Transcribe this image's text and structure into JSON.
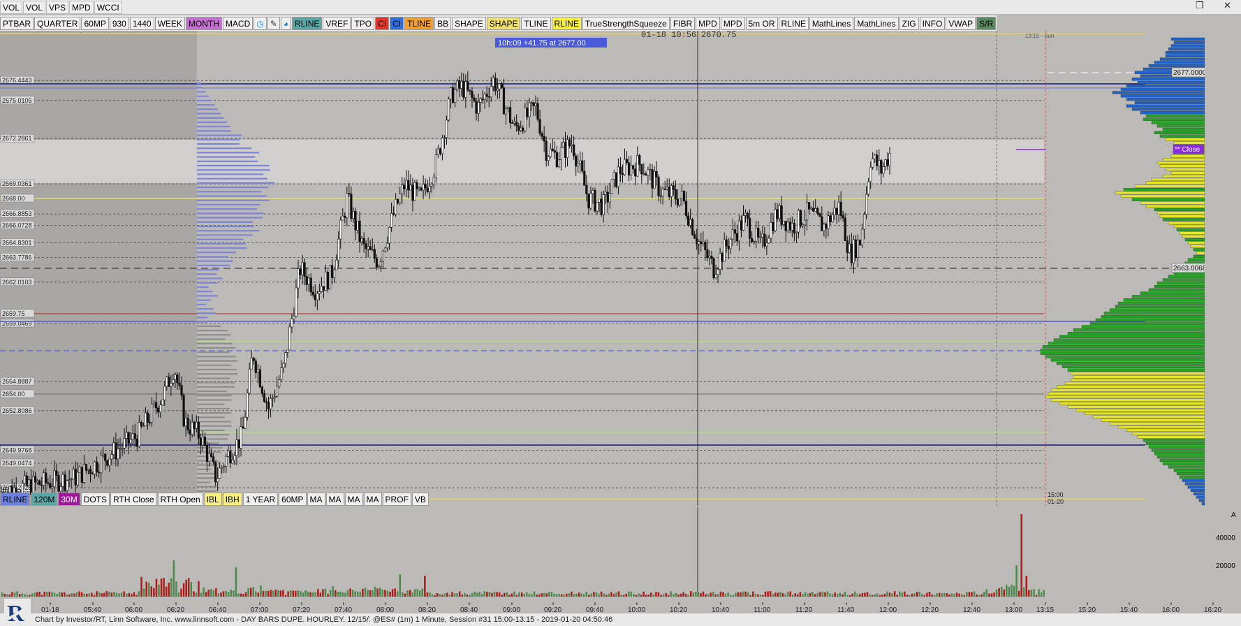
{
  "top_menu": [
    "VOL",
    "VOL",
    "VPS",
    "MPD",
    "WCCI"
  ],
  "window_controls": {
    "restore_icon": "restore-icon",
    "close_icon": "close-icon"
  },
  "toolbar": [
    {
      "label": "PTBAR"
    },
    {
      "label": "QUARTER"
    },
    {
      "label": "60MP"
    },
    {
      "label": "930"
    },
    {
      "label": "1440"
    },
    {
      "label": "WEEK"
    },
    {
      "label": "MONTH",
      "bg": "#c86fd6"
    },
    {
      "label": "MACD"
    },
    {
      "icon": "clock-icon",
      "glyph": "◷",
      "fg": "#1a7bd8"
    },
    {
      "icon": "pencil-icon",
      "glyph": "✎",
      "fg": "#333"
    },
    {
      "icon": "palette-icon",
      "glyph": "◕",
      "fg": "#1a7bd8"
    },
    {
      "label": "RLINE",
      "bg": "#5aa7a6"
    },
    {
      "label": "VREF"
    },
    {
      "label": "TPO"
    },
    {
      "label": "CI",
      "bg": "#e5352b"
    },
    {
      "label": "CI",
      "bg": "#2e6fe0"
    },
    {
      "label": "TLINE",
      "bg": "#f0a030"
    },
    {
      "label": "BB"
    },
    {
      "label": "SHAPE"
    },
    {
      "label": "SHAPE",
      "bg": "#f0e070"
    },
    {
      "label": "TLINE"
    },
    {
      "label": "RLINE",
      "bg": "#f7f040"
    },
    {
      "label": "TrueStrengthSqueeze"
    },
    {
      "label": "FIBR"
    },
    {
      "label": "MPD"
    },
    {
      "label": "MPD"
    },
    {
      "label": "5m OR"
    },
    {
      "label": "RLINE"
    },
    {
      "label": "MathLines"
    },
    {
      "label": "MathLines"
    },
    {
      "label": "ZIG"
    },
    {
      "label": "INFO"
    },
    {
      "label": "VWAP"
    },
    {
      "label": "S/R",
      "bg": "#5c8a60"
    }
  ],
  "bottom_toolbar": [
    {
      "label": "RLINE",
      "bg": "#6d7fe0"
    },
    {
      "label": "120M",
      "bg": "#5aa7a6"
    },
    {
      "label": "30M",
      "bg": "#a0189a",
      "fg": "#fff"
    },
    {
      "label": "DOTS"
    },
    {
      "label": "RTH Close"
    },
    {
      "label": "RTH Open"
    },
    {
      "label": "IBL",
      "bg": "#f7f080"
    },
    {
      "label": "IBH",
      "bg": "#f7f080"
    },
    {
      "label": "1 YEAR"
    },
    {
      "label": "60MP"
    },
    {
      "label": "MA"
    },
    {
      "label": "MA"
    },
    {
      "label": "MA"
    },
    {
      "label": "MA"
    },
    {
      "label": "PROF"
    },
    {
      "label": "VB"
    }
  ],
  "chart_overlay": {
    "tooltip": "10h:09  +41.75 at 2677.00",
    "cursor_readout": "01-18 10:56",
    "cursor_price": "2670.75",
    "cursor_time_label": "13:15 - Sun",
    "session_end_label": "15:00",
    "session_end_date": "01-20",
    "close_label": "** Close",
    "close_price": "2671.50",
    "level_2677": "2677.0000",
    "level_2663": "2663.0068",
    "level_green_1": "2657.75",
    "level_green_2": "2651.25"
  },
  "colors": {
    "background": "#bcbab7",
    "up": "#4d8a4d",
    "down": "#b21a1a",
    "profile_green": "#22a322",
    "profile_yellow": "#e5e628",
    "profile_blue": "#1f62c9",
    "left_profile": "#7e84d8"
  },
  "chart_data": {
    "type": "candlestick",
    "price_axis_ticks": [
      "2675",
      "2670",
      "2665",
      "2660",
      "2655",
      "2650"
    ],
    "price_range": [
      2646,
      2680
    ],
    "time_axis_ticks": [
      "01-18",
      "05:40",
      "06:00",
      "06:20",
      "06:40",
      "07:00",
      "07:20",
      "07:40",
      "08:00",
      "08:20",
      "08:40",
      "09:00",
      "09:20",
      "09:40",
      "10:00",
      "10:20",
      "10:40",
      "11:00",
      "11:20",
      "11:40",
      "12:00",
      "12:20",
      "12:40",
      "13:00",
      "13:15",
      "15:20",
      "15:40",
      "16:00",
      "16:20"
    ],
    "levels": [
      {
        "label": "2676.4443",
        "price": 2676.44
      },
      {
        "label": "2675.0105",
        "price": 2675.01
      },
      {
        "label": "2672.2861",
        "price": 2672.29
      },
      {
        "label": "2669.0361",
        "price": 2669.04
      },
      {
        "label": "2668.00",
        "price": 2668.0
      },
      {
        "label": "2666.8853",
        "price": 2666.89
      },
      {
        "label": "2666.0728",
        "price": 2666.07
      },
      {
        "label": "2664.8301",
        "price": 2664.83
      },
      {
        "label": "2663.7786",
        "price": 2663.78
      },
      {
        "label": "2662.0103",
        "price": 2662.01
      },
      {
        "label": "2659.75",
        "price": 2659.75
      },
      {
        "label": "2659.0469",
        "price": 2659.05
      },
      {
        "label": "2654.8887",
        "price": 2654.89
      },
      {
        "label": "2654.00",
        "price": 2654.0
      },
      {
        "label": "2652.8086",
        "price": 2652.81
      },
      {
        "label": "2649.9768",
        "price": 2649.98
      },
      {
        "label": "2649.0474",
        "price": 2649.05
      },
      {
        "label": "2647.2925",
        "price": 2647.29
      }
    ],
    "price_path": [
      [
        0,
        2647
      ],
      [
        0.03,
        2647.5
      ],
      [
        0.07,
        2648
      ],
      [
        0.1,
        2649.5
      ],
      [
        0.13,
        2651
      ],
      [
        0.155,
        2654
      ],
      [
        0.165,
        2656
      ],
      [
        0.175,
        2652
      ],
      [
        0.19,
        2651
      ],
      [
        0.205,
        2648
      ],
      [
        0.215,
        2649.5
      ],
      [
        0.23,
        2651
      ],
      [
        0.24,
        2657
      ],
      [
        0.255,
        2653
      ],
      [
        0.27,
        2656
      ],
      [
        0.285,
        2663
      ],
      [
        0.3,
        2661.5
      ],
      [
        0.315,
        2662.5
      ],
      [
        0.33,
        2668
      ],
      [
        0.345,
        2664.5
      ],
      [
        0.36,
        2663.5
      ],
      [
        0.375,
        2667
      ],
      [
        0.385,
        2669
      ],
      [
        0.4,
        2668
      ],
      [
        0.415,
        2670.5
      ],
      [
        0.43,
        2675.5
      ],
      [
        0.44,
        2676
      ],
      [
        0.455,
        2674.5
      ],
      [
        0.47,
        2676.5
      ],
      [
        0.49,
        2673
      ],
      [
        0.51,
        2674.5
      ],
      [
        0.52,
        2671.5
      ],
      [
        0.53,
        2671
      ],
      [
        0.545,
        2672
      ],
      [
        0.56,
        2668
      ],
      [
        0.575,
        2667.5
      ],
      [
        0.59,
        2670
      ],
      [
        0.61,
        2670.5
      ],
      [
        0.63,
        2668.5
      ],
      [
        0.65,
        2668
      ],
      [
        0.665,
        2665
      ],
      [
        0.68,
        2663
      ],
      [
        0.695,
        2665
      ],
      [
        0.71,
        2666.5
      ],
      [
        0.725,
        2664.5
      ],
      [
        0.74,
        2667
      ],
      [
        0.755,
        2666
      ],
      [
        0.77,
        2667
      ],
      [
        0.785,
        2666
      ],
      [
        0.8,
        2667.5
      ],
      [
        0.81,
        2664
      ],
      [
        0.82,
        2665
      ],
      [
        0.83,
        2671
      ],
      [
        0.84,
        2670
      ],
      [
        0.85,
        2671.5
      ]
    ],
    "profile_right": [
      2672,
      2671,
      2672,
      2673,
      2674,
      2674,
      2676,
      2678,
      2680,
      2682,
      2685,
      2683,
      2686,
      2684,
      2688,
      2690,
      2693,
      2690,
      2688,
      2685,
      2688,
      2686,
      2683,
      2681,
      2682,
      2679,
      2677,
      2675,
      2678,
      2676,
      2674,
      2671,
      2669,
      2667,
      2669,
      2672,
      2675,
      2677,
      2676,
      2674,
      2672,
      2675,
      2679,
      2681,
      2685,
      2689,
      2692,
      2690,
      2686,
      2683,
      2681,
      2678,
      2677,
      2676,
      2675,
      2673,
      2671,
      2670,
      2669,
      2668,
      2667,
      2666,
      2665,
      2664,
      2663,
      2664,
      2666,
      2667,
      2669,
      2670,
      2671,
      2673,
      2675,
      2677,
      2678,
      2680,
      2683,
      2686,
      2689,
      2691,
      2692,
      2694,
      2696,
      2697,
      2699,
      2701,
      2704,
      2707,
      2709,
      2712,
      2714,
      2716,
      2718,
      2720,
      2719,
      2717,
      2715,
      2713,
      2711,
      2709,
      2708,
      2707,
      2708,
      2710,
      2713,
      2715,
      2716,
      2717,
      2715,
      2712,
      2709,
      2706,
      2703,
      2700,
      2697,
      2694,
      2691,
      2688,
      2686,
      2684,
      2682,
      2681,
      2680,
      2679,
      2678,
      2677,
      2676,
      2675,
      2673,
      2671,
      2670,
      2669,
      2668,
      2667,
      2666,
      2665,
      2664,
      2663,
      2662,
      2661
    ]
  },
  "footer_text": "Chart by Investor/RT, Linn Software, Inc. www.linnsoft.com - DAY BARS DUPE. HOURLEY.  12/15/: @ES# (1m) 1 Minute, Session #31 15:00-13:15 - 2019-01-20 04:50:46",
  "volume_axis": [
    "40000",
    "20000"
  ],
  "volume_axis_label": "A"
}
